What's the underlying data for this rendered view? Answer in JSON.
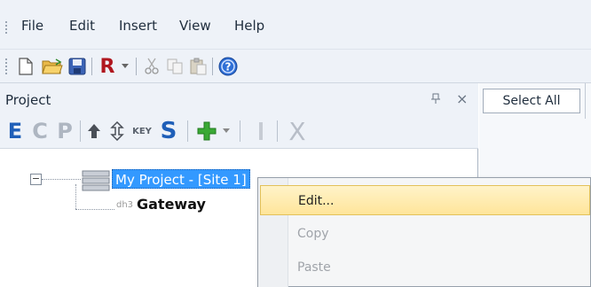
{
  "menu": {
    "items": [
      "File",
      "Edit",
      "Insert",
      "View",
      "Help"
    ]
  },
  "toolbar": {
    "icons": [
      "new-icon",
      "open-icon",
      "save-icon",
      "report-icon",
      "cut-icon",
      "copy-icon",
      "paste-icon",
      "help-icon"
    ],
    "report_label": "R"
  },
  "panel": {
    "title": "Project",
    "pin_glyph": "Ȩ",
    "close_glyph": "×",
    "toolbar": {
      "e": "E",
      "c": "C",
      "p": "P",
      "key": "KEY",
      "s": "S",
      "x": "X"
    }
  },
  "tree": {
    "expander": "−",
    "project_label": "My Project - [Site 1]",
    "gateway_prefix": "dh3",
    "gateway_label": "Gateway"
  },
  "grid": {
    "select_all": "Select All"
  },
  "context_menu": {
    "items": [
      {
        "label": "Edit...",
        "state": "highlighted"
      },
      {
        "label": "Copy",
        "state": "disabled"
      },
      {
        "label": "Paste",
        "state": "disabled"
      }
    ]
  },
  "colors": {
    "selection": "#3399ff",
    "menu_highlight": "#ffe59a",
    "e_blue": "#1f5fb8",
    "s_blue": "#1f5fb8",
    "plus_green": "#3aa935",
    "r_red": "#b0171f"
  }
}
